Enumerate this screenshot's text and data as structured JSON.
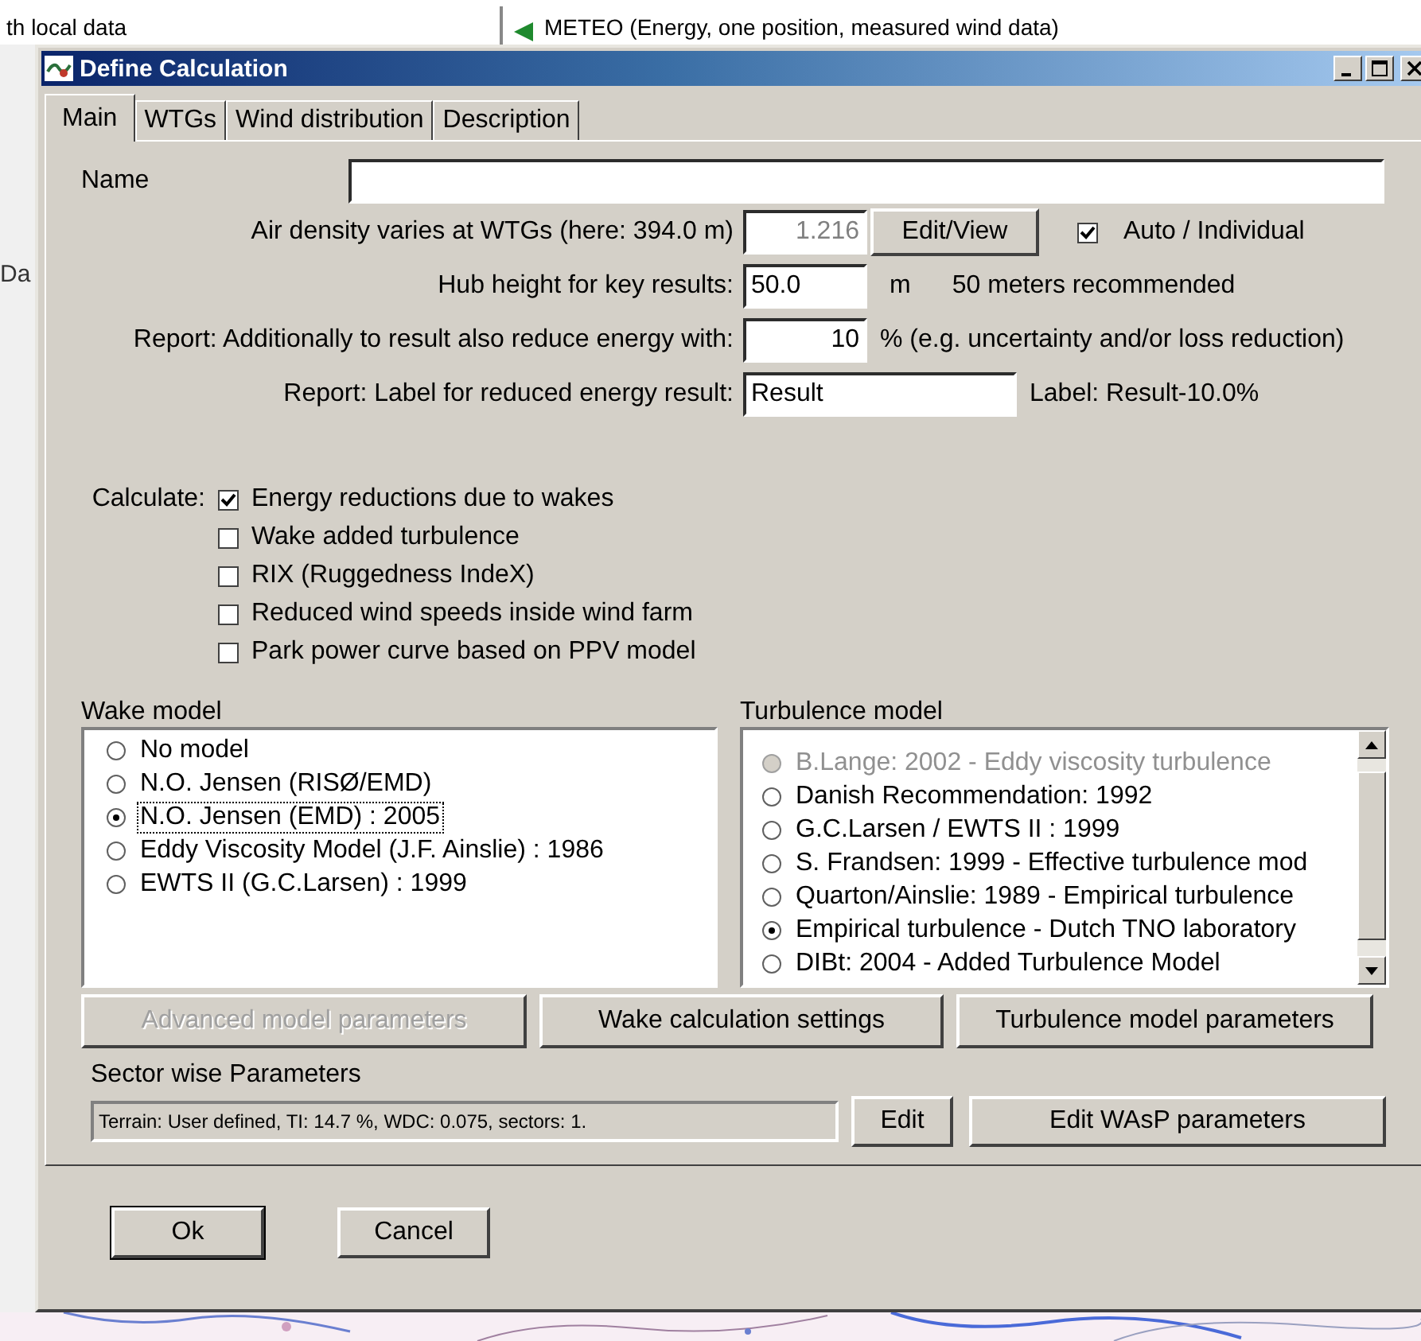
{
  "background": {
    "left_text": "th local data",
    "list_item": "METEO (Energy, one position, measured wind data)",
    "side_text": "Da"
  },
  "window": {
    "title": "Define Calculation"
  },
  "tabs": [
    {
      "label": "Main",
      "selected": true
    },
    {
      "label": "WTGs",
      "selected": false
    },
    {
      "label": "Wind distribution",
      "selected": false
    },
    {
      "label": "Description",
      "selected": false
    }
  ],
  "name": {
    "label": "Name"
  },
  "air_density": {
    "label": "Air density varies at WTGs (here: 394.0 m)",
    "value": "1.216",
    "disabled": true,
    "button": "Edit/View",
    "auto": {
      "label": "Auto / Individual",
      "checked": true
    }
  },
  "hub_height": {
    "label": "Hub height for key results:",
    "value": "50.0",
    "unit": "m",
    "note": "50 meters recommended"
  },
  "reduce": {
    "label": "Report: Additionally to result also reduce energy with:",
    "value": "10",
    "note": "% (e.g. uncertainty and/or loss reduction)"
  },
  "result_label": {
    "label": "Report: Label for reduced energy result:",
    "value": "Result",
    "note": "Label: Result-10.0%"
  },
  "calculate": {
    "label": "Calculate:",
    "options": [
      {
        "label": "Energy reductions due to wakes",
        "checked": true
      },
      {
        "label": "Wake added turbulence",
        "checked": false
      },
      {
        "label": "RIX (Ruggedness IndeX)",
        "checked": false
      },
      {
        "label": "Reduced wind speeds inside wind farm",
        "checked": false
      },
      {
        "label": "Park power curve based on PPV model",
        "checked": false
      }
    ]
  },
  "wake_model": {
    "label": "Wake model",
    "items": [
      {
        "label": "No model",
        "selected": false,
        "focused": false
      },
      {
        "label": "N.O. Jensen (RISØ/EMD)",
        "selected": false,
        "focused": false
      },
      {
        "label": "N.O. Jensen (EMD) : 2005",
        "selected": true,
        "focused": true
      },
      {
        "label": "Eddy Viscosity Model (J.F. Ainslie) : 1986",
        "selected": false,
        "focused": false
      },
      {
        "label": "EWTS II (G.C.Larsen) : 1999",
        "selected": false,
        "focused": false
      }
    ]
  },
  "turbulence_model": {
    "label": "Turbulence model",
    "items": [
      {
        "label": "B.Lange: 2002 - Eddy viscosity turbulence",
        "selected": false,
        "disabled": true
      },
      {
        "label": "Danish Recommendation: 1992",
        "selected": false,
        "disabled": false
      },
      {
        "label": "G.C.Larsen / EWTS II : 1999",
        "selected": false,
        "disabled": false
      },
      {
        "label": "S. Frandsen: 1999 - Effective turbulence mod",
        "selected": false,
        "disabled": false
      },
      {
        "label": "Quarton/Ainslie: 1989 - Empirical turbulence",
        "selected": false,
        "disabled": false
      },
      {
        "label": "Empirical turbulence - Dutch TNO laboratory",
        "selected": true,
        "disabled": false
      },
      {
        "label": "DIBt: 2004 - Added Turbulence Model",
        "selected": false,
        "disabled": false
      }
    ]
  },
  "model_buttons": [
    {
      "label": "Advanced model parameters",
      "disabled": true
    },
    {
      "label": "Wake calculation settings",
      "disabled": false
    },
    {
      "label": "Turbulence model parameters",
      "disabled": false
    }
  ],
  "sector": {
    "label": "Sector wise Parameters",
    "value": "Terrain: User defined, TI: 14.7 %, WDC: 0.075, sectors: 1.",
    "edit": "Edit",
    "wasp": "Edit WAsP parameters"
  },
  "footer_buttons": [
    {
      "label": "Ok",
      "default": true
    },
    {
      "label": "Cancel",
      "default": false
    }
  ]
}
